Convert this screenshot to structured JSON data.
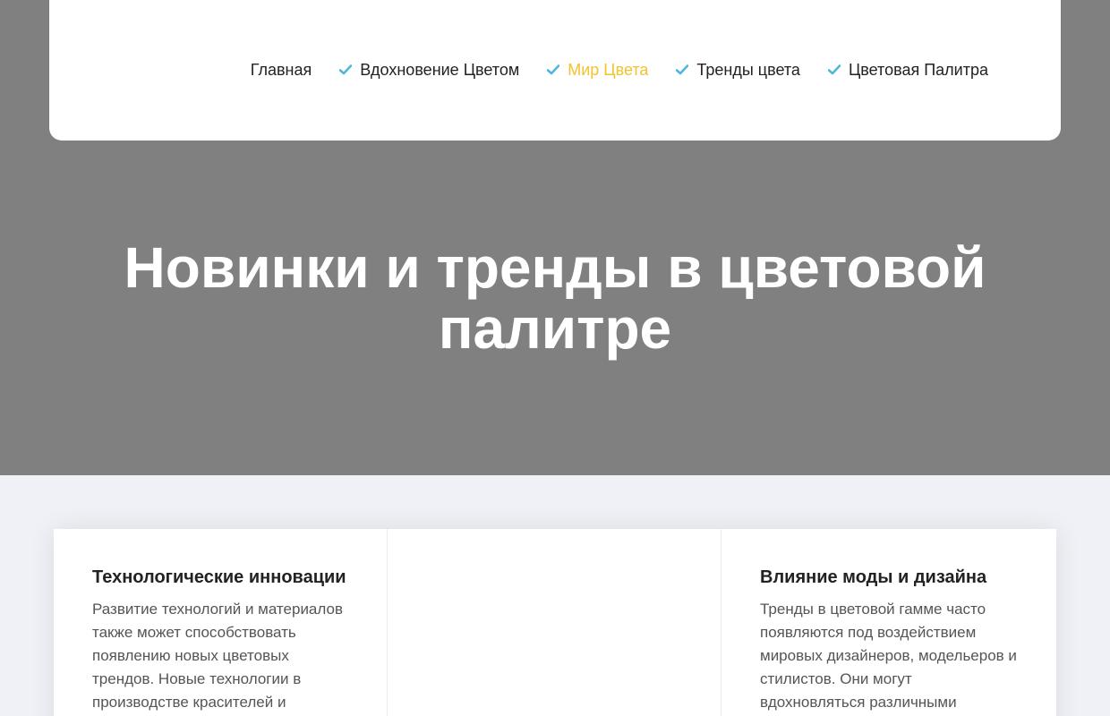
{
  "colors": {
    "hero_background": "#808080",
    "accent_check": "#4fb7de",
    "active_nav": "#f2c230",
    "page_background": "#f0f1f6"
  },
  "nav": {
    "items": [
      {
        "label": "Главная",
        "icon": null
      },
      {
        "label": "Вдохновение Цветом",
        "icon": "check-icon"
      },
      {
        "label": "Мир Цвета",
        "icon": "check-icon",
        "active": true
      },
      {
        "label": "Тренды цвета",
        "icon": "check-icon"
      },
      {
        "label": "Цветовая Палитра",
        "icon": "check-icon"
      }
    ]
  },
  "hero": {
    "title": "Новинки и тренды в цветовой палитре"
  },
  "cards": [
    {
      "title": "Технологические инновации",
      "text": "Развитие технологий и материалов также может способствовать появлению новых цветовых трендов. Новые технологии в производстве красителей и"
    },
    {
      "title": "",
      "text": ""
    },
    {
      "title": "Влияние моды и дизайна",
      "text": "Тренды в цветовой гамме часто появляются под воздействием мировых дизайнеров, модельеров и стилистов. Они могут вдохновляться различными"
    }
  ]
}
